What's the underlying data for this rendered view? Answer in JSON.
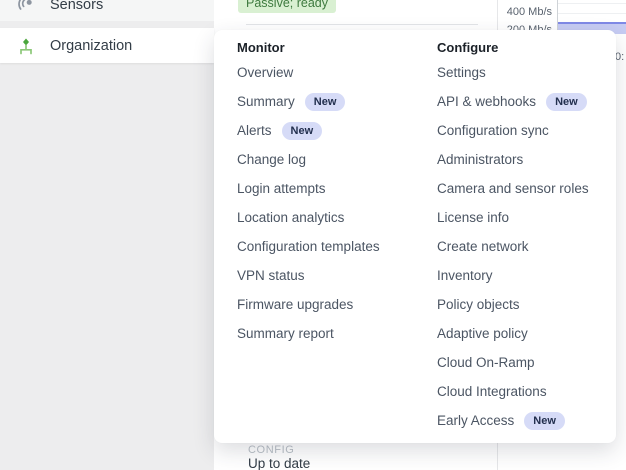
{
  "sidebar": {
    "items": [
      {
        "label": "Sensors",
        "icon": "sensors-icon",
        "active": false
      },
      {
        "label": "Organization",
        "icon": "organization-icon",
        "active": true
      }
    ]
  },
  "content": {
    "status_badge": "Passive; ready",
    "footer_label": "CONFIG",
    "footer_value": "Up to date",
    "clipped_axis_label": "0:"
  },
  "usage_chart": {
    "type": "area",
    "y_tick_labels": [
      "400 Mb/s",
      "200 Mb/s"
    ],
    "bar_fill": "#c7ccf3",
    "bar_edge": "#7f89e6"
  },
  "menu": {
    "columns": [
      {
        "header": "Monitor",
        "items": [
          {
            "label": "Overview"
          },
          {
            "label": "Summary",
            "badge": "New"
          },
          {
            "label": "Alerts",
            "badge": "New"
          },
          {
            "label": "Change log"
          },
          {
            "label": "Login attempts"
          },
          {
            "label": "Location analytics"
          },
          {
            "label": "Configuration templates"
          },
          {
            "label": "VPN status"
          },
          {
            "label": "Firmware upgrades"
          },
          {
            "label": "Summary report"
          }
        ]
      },
      {
        "header": "Configure",
        "items": [
          {
            "label": "Settings"
          },
          {
            "label": "API & webhooks",
            "badge": "New"
          },
          {
            "label": "Configuration sync"
          },
          {
            "label": "Administrators"
          },
          {
            "label": "Camera and sensor roles"
          },
          {
            "label": "License info"
          },
          {
            "label": "Create network"
          },
          {
            "label": "Inventory"
          },
          {
            "label": "Policy objects"
          },
          {
            "label": "Adaptive policy"
          },
          {
            "label": "Cloud On-Ramp"
          },
          {
            "label": "Cloud Integrations"
          },
          {
            "label": "Early Access",
            "badge": "New"
          }
        ]
      }
    ]
  },
  "colors": {
    "new_badge_bg": "#d6dbf7",
    "new_badge_text": "#222f4e",
    "status_ok_bg": "#d9f0d2",
    "status_ok_text": "#3e7a3f",
    "org_icon_green": "#4aa63c",
    "org_icon_light_green": "#8cc878"
  }
}
